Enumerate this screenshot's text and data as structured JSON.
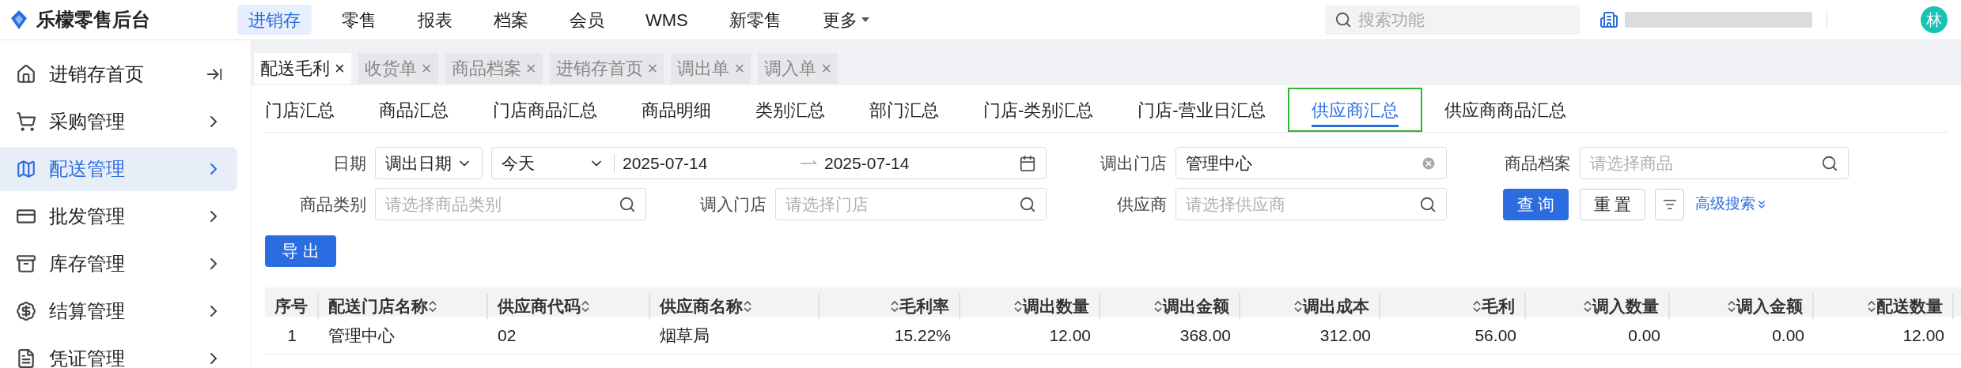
{
  "app": {
    "name": "乐檬零售后台"
  },
  "top_nav": [
    {
      "label": "进销存",
      "selected": true,
      "dropdown": false
    },
    {
      "label": "零售",
      "selected": false,
      "dropdown": false
    },
    {
      "label": "报表",
      "selected": false,
      "dropdown": false
    },
    {
      "label": "档案",
      "selected": false,
      "dropdown": false
    },
    {
      "label": "会员",
      "selected": false,
      "dropdown": false
    },
    {
      "label": "WMS",
      "selected": false,
      "dropdown": false
    },
    {
      "label": "新零售",
      "selected": false,
      "dropdown": false
    },
    {
      "label": "更多",
      "selected": false,
      "dropdown": true
    }
  ],
  "search": {
    "placeholder": "搜索功能"
  },
  "avatar": "林",
  "sidebar": {
    "items": [
      {
        "label": "进销存首页",
        "kind": "link",
        "selected": false
      },
      {
        "label": "采购管理",
        "kind": "menu",
        "selected": false
      },
      {
        "label": "配送管理",
        "kind": "menu",
        "selected": true
      },
      {
        "label": "批发管理",
        "kind": "menu",
        "selected": false
      },
      {
        "label": "库存管理",
        "kind": "menu",
        "selected": false
      },
      {
        "label": "结算管理",
        "kind": "menu",
        "selected": false
      },
      {
        "label": "凭证管理",
        "kind": "menu",
        "selected": false
      }
    ]
  },
  "tabs": [
    {
      "label": "配送毛利",
      "selected": true,
      "close": "×"
    },
    {
      "label": "收货单",
      "selected": false,
      "close": "×"
    },
    {
      "label": "商品档案",
      "selected": false,
      "close": "×"
    },
    {
      "label": "进销存首页",
      "selected": false,
      "close": "×"
    },
    {
      "label": "调出单",
      "selected": false,
      "close": "×"
    },
    {
      "label": "调入单",
      "selected": false,
      "close": "×"
    }
  ],
  "report_tabs": [
    {
      "label": "门店汇总",
      "selected": false
    },
    {
      "label": "商品汇总",
      "selected": false
    },
    {
      "label": "门店商品汇总",
      "selected": false
    },
    {
      "label": "商品明细",
      "selected": false
    },
    {
      "label": "类别汇总",
      "selected": false
    },
    {
      "label": "部门汇总",
      "selected": false
    },
    {
      "label": "门店-类别汇总",
      "selected": false
    },
    {
      "label": "门店-营业日汇总",
      "selected": false
    },
    {
      "label": "供应商汇总",
      "selected": true
    },
    {
      "label": "供应商商品汇总",
      "selected": false
    }
  ],
  "filters": {
    "date": {
      "label": "日期",
      "mode": "调出日期",
      "preset": "今天",
      "start": "2025-07-14",
      "end": "2025-07-14"
    },
    "out_store": {
      "label": "调出门店",
      "value": "管理中心"
    },
    "product": {
      "label": "商品档案",
      "placeholder": "请选择商品"
    },
    "category": {
      "label": "商品类别",
      "placeholder": "请选择商品类别"
    },
    "in_store": {
      "label": "调入门店",
      "placeholder": "请选择门店"
    },
    "supplier": {
      "label": "供应商",
      "placeholder": "请选择供应商"
    }
  },
  "buttons": {
    "query": "查 询",
    "reset": "重 置",
    "advanced": "高级搜索",
    "export": "导 出"
  },
  "table": {
    "columns": [
      {
        "label": "序号",
        "kind": "index",
        "sortable": false
      },
      {
        "label": "配送门店名称",
        "kind": "text",
        "sortable": true
      },
      {
        "label": "供应商代码",
        "kind": "text",
        "sortable": true
      },
      {
        "label": "供应商名称",
        "kind": "text",
        "sortable": true
      },
      {
        "label": "毛利率",
        "kind": "number",
        "sortable": true
      },
      {
        "label": "调出数量",
        "kind": "number",
        "sortable": true
      },
      {
        "label": "调出金额",
        "kind": "number",
        "sortable": true
      },
      {
        "label": "调出成本",
        "kind": "number",
        "sortable": true
      },
      {
        "label": "毛利",
        "kind": "number",
        "sortable": true
      },
      {
        "label": "调入数量",
        "kind": "number",
        "sortable": true
      },
      {
        "label": "调入金额",
        "kind": "number",
        "sortable": true
      },
      {
        "label": "配送数量",
        "kind": "number",
        "sortable": true
      }
    ],
    "rows": [
      [
        "1",
        "管理中心",
        "02",
        "烟草局",
        "15.22%",
        "12.00",
        "368.00",
        "312.00",
        "56.00",
        "0.00",
        "0.00",
        "12.00"
      ]
    ]
  }
}
